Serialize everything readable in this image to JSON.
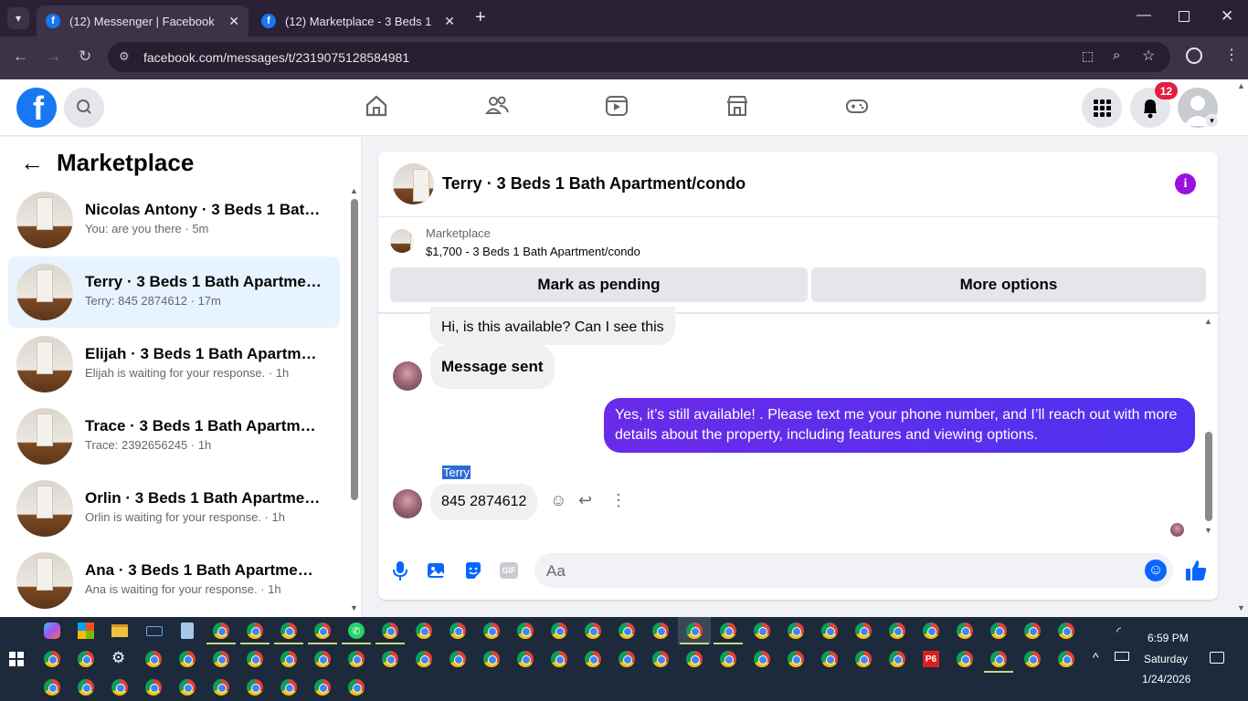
{
  "browser": {
    "tabs": [
      {
        "title": "(12) Messenger | Facebook"
      },
      {
        "title": "(12) Marketplace - 3 Beds 1 Bat"
      }
    ],
    "url": "facebook.com/messages/t/2319075128584981"
  },
  "header": {
    "notification_count": "12"
  },
  "sidebar": {
    "title": "Marketplace",
    "conversations": [
      {
        "name": "Nicolas Antony · 3 Beds 1 Bath A...",
        "preview": "You: are you there · 5m"
      },
      {
        "name": "Terry · 3 Beds 1 Bath Apartment/...",
        "preview": "Terry: 845 2874612 · 17m"
      },
      {
        "name": "Elijah · 3 Beds 1 Bath Apartment/...",
        "preview": "Elijah is waiting for your response. · 1h"
      },
      {
        "name": "Trace · 3 Beds 1 Bath Apartment/...",
        "preview": "Trace: 2392656245 · 1h"
      },
      {
        "name": "Orlin · 3 Beds 1 Bath Apartment/...",
        "preview": "Orlin is waiting for your response. · 1h"
      },
      {
        "name": "Ana · 3 Beds 1 Bath Apartment/c...",
        "preview": "Ana is waiting for your response. · 1h"
      }
    ]
  },
  "chat": {
    "title": "Terry · 3 Beds 1 Bath Apartment/condo",
    "listing_label": "Marketplace",
    "listing_detail": "$1,700 - 3 Beds 1 Bath Apartment/condo",
    "mark_pending": "Mark as pending",
    "more_options": "More options",
    "messages": [
      {
        "text": "Hi, is this available? Can I see this"
      },
      {
        "text": "Message sent"
      },
      {
        "text": "Yes, it’s still available! . Please text me your phone number, and I’ll reach out with more details about the property, including features and viewing options."
      },
      {
        "sender": "Terry",
        "text": "845 2874612"
      }
    ],
    "composer_placeholder": "Aa",
    "gif_label": "GIF"
  },
  "taskbar": {
    "time": "6:59 PM",
    "day": "Saturday",
    "date": "1/24/2026",
    "p6_label": "P6"
  }
}
